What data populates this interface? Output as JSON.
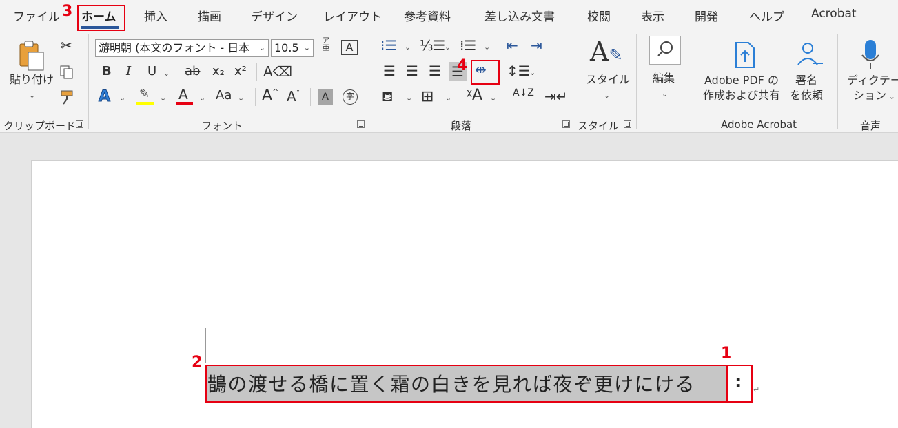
{
  "tabs": [
    "ファイル",
    "ホーム",
    "挿入",
    "描画",
    "デザイン",
    "レイアウト",
    "参考資料",
    "差し込み文書",
    "校閲",
    "表示",
    "開発",
    "ヘルプ",
    "Acrobat"
  ],
  "clipboard": {
    "paste_label": "貼り付け",
    "group_label": "クリップボード"
  },
  "font": {
    "font_name": "游明朝 (本文のフォント - 日本",
    "font_size": "10.5",
    "phonetic_icon": "ア亜",
    "group_label": "フォント",
    "bold": "B",
    "italic": "I",
    "underline": "U",
    "strike": "ab",
    "subscript": "x₂",
    "superscript": "x²",
    "text_effect": "A",
    "highlight": "A",
    "font_color": "A",
    "change_case": "Aa",
    "grow": "A^",
    "shrink": "Aˇ",
    "shading": "A",
    "enclose": "字"
  },
  "paragraph": {
    "group_label": "段落",
    "sort": "A↓Z"
  },
  "styles": {
    "label": "スタイル",
    "group_label": "スタイル"
  },
  "editing": {
    "label": "編集"
  },
  "acrobat": {
    "create_pdf_line1": "Adobe PDF の",
    "create_pdf_line2": "作成および共有",
    "sign_line1": "署名",
    "sign_line2": "を依頼",
    "group_label": "Adobe Acrobat"
  },
  "voice": {
    "dictate_line1": "ディクテー",
    "dictate_line2": "ション",
    "group_label": "音声"
  },
  "document": {
    "text": "鵲の渡せる橋に置く霜の白きを見れば夜ぞ更けにける",
    "colon": ":",
    "para_mark": "↵"
  },
  "annotations": {
    "n1": "1",
    "n2": "2",
    "n3": "3",
    "n4": "4"
  },
  "colors": {
    "highlight_yellow": "#ffff00",
    "font_red": "#e60012",
    "annotation_red": "#e60012",
    "tab_underline": "#2b579a"
  }
}
